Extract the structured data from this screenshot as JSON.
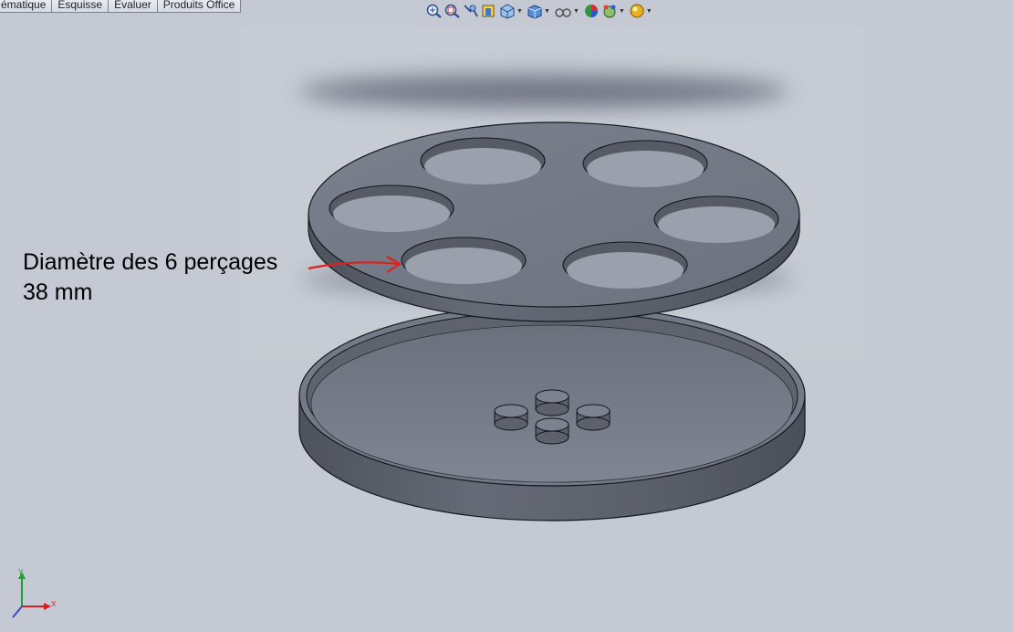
{
  "command_tabs": [
    "ématique",
    "Esquisse",
    "Evaluer",
    "Produits Office"
  ],
  "view_toolbar": {
    "tools": [
      "zoom-to-fit-icon",
      "zoom-to-area-icon",
      "previous-view-icon",
      "section-view-icon",
      "view-orientation-icon",
      "display-style-icon",
      "hide-show-items-icon",
      "edit-appearance-icon",
      "apply-scene-icon",
      "view-settings-icon"
    ]
  },
  "annotation": {
    "line1": "Diamètre des 6 perçages",
    "line2": "38 mm",
    "arrow_color": "#e0201c"
  },
  "triad": {
    "x_label": "X",
    "y_label": "Y",
    "x_color": "#d22020",
    "y_color": "#20a030"
  },
  "colors": {
    "background": "#c5c9d3",
    "part_face": "#737986",
    "part_side": "#5d626d",
    "edge": "#14161b"
  }
}
